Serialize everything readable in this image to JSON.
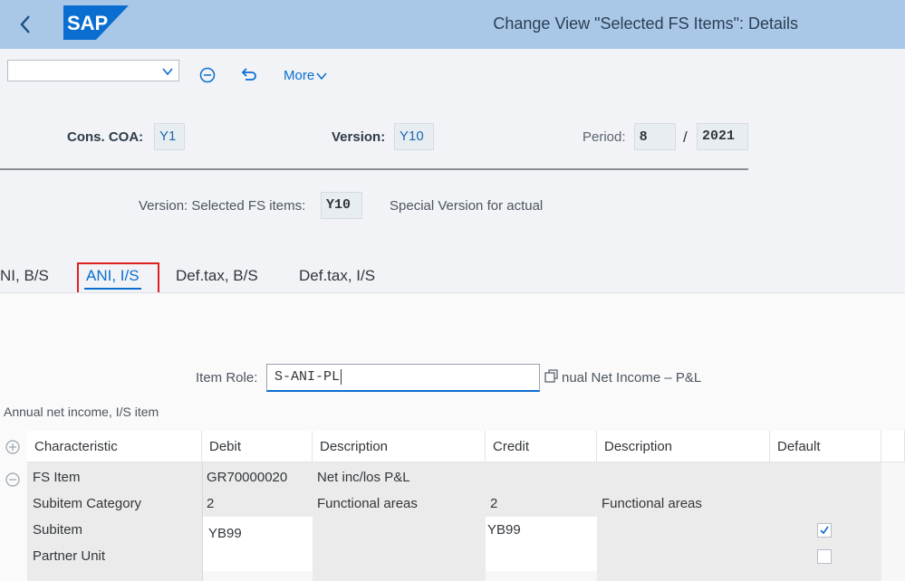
{
  "shell": {
    "logo_text": "SAP",
    "title": "Change View \"Selected FS Items\": Details"
  },
  "toolbar": {
    "more_label": "More"
  },
  "header": {
    "cons_coa_label": "Cons. COA:",
    "cons_coa_value": "Y1",
    "version_label": "Version:",
    "version_value": "Y10",
    "period_label": "Period:",
    "period_value": "8",
    "period_sep": "/",
    "year_value": "2021",
    "version_selected_label": "Version: Selected FS items:",
    "version_selected_value": "Y10",
    "version_selected_desc": "Special Version for actual"
  },
  "tabs": [
    {
      "label": "NI, B/S"
    },
    {
      "label": "ANI, I/S"
    },
    {
      "label": "Def.tax, B/S"
    },
    {
      "label": "Def.tax, I/S"
    }
  ],
  "item_role": {
    "label": "Item Role:",
    "value": "S-ANI-PL",
    "desc": "nual Net Income – P&L"
  },
  "section_title": "Annual net income, I/S item",
  "table": {
    "headers": [
      "Characteristic",
      "Debit",
      "Description",
      "Credit",
      "Description",
      "Default"
    ],
    "rows": [
      {
        "characteristic": "FS Item",
        "debit": "GR70000020",
        "debit_desc": "Net inc/los P&L",
        "credit": "",
        "credit_desc": ""
      },
      {
        "characteristic": "Subitem Category",
        "debit": "2",
        "debit_desc": "Functional areas",
        "credit": "2",
        "credit_desc": "Functional areas"
      },
      {
        "characteristic": "Subitem",
        "debit": "YB99",
        "debit_desc": "",
        "credit": "YB99",
        "credit_desc": ""
      },
      {
        "characteristic": "Partner Unit",
        "debit": "",
        "debit_desc": "",
        "credit": "",
        "credit_desc": ""
      }
    ]
  },
  "colors": {
    "shell_bg": "#a9c7e7",
    "accent": "#0a6ed1",
    "highlight": "#e02020"
  }
}
